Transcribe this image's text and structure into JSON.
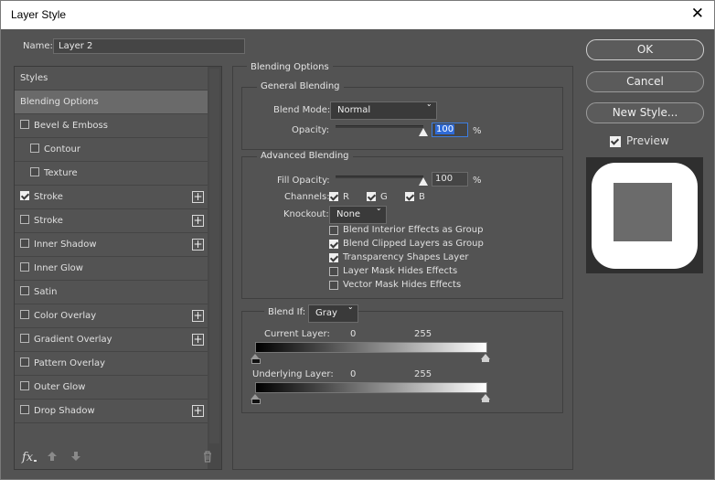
{
  "window": {
    "title": "Layer Style",
    "close_glyph": "✕"
  },
  "name_field": {
    "label": "Name:",
    "value": "Layer 2"
  },
  "styles_list": [
    {
      "label": "Styles",
      "checkbox": false,
      "checked": false,
      "plus": false,
      "indent": false,
      "selected": false
    },
    {
      "label": "Blending Options",
      "checkbox": false,
      "checked": false,
      "plus": false,
      "indent": false,
      "selected": true
    },
    {
      "label": "Bevel & Emboss",
      "checkbox": true,
      "checked": false,
      "plus": false,
      "indent": false,
      "selected": false
    },
    {
      "label": "Contour",
      "checkbox": true,
      "checked": false,
      "plus": false,
      "indent": true,
      "selected": false
    },
    {
      "label": "Texture",
      "checkbox": true,
      "checked": false,
      "plus": false,
      "indent": true,
      "selected": false
    },
    {
      "label": "Stroke",
      "checkbox": true,
      "checked": true,
      "plus": true,
      "indent": false,
      "selected": false
    },
    {
      "label": "Stroke",
      "checkbox": true,
      "checked": false,
      "plus": true,
      "indent": false,
      "selected": false
    },
    {
      "label": "Inner Shadow",
      "checkbox": true,
      "checked": false,
      "plus": true,
      "indent": false,
      "selected": false
    },
    {
      "label": "Inner Glow",
      "checkbox": true,
      "checked": false,
      "plus": false,
      "indent": false,
      "selected": false
    },
    {
      "label": "Satin",
      "checkbox": true,
      "checked": false,
      "plus": false,
      "indent": false,
      "selected": false
    },
    {
      "label": "Color Overlay",
      "checkbox": true,
      "checked": false,
      "plus": true,
      "indent": false,
      "selected": false
    },
    {
      "label": "Gradient Overlay",
      "checkbox": true,
      "checked": false,
      "plus": true,
      "indent": false,
      "selected": false
    },
    {
      "label": "Pattern Overlay",
      "checkbox": true,
      "checked": false,
      "plus": false,
      "indent": false,
      "selected": false
    },
    {
      "label": "Outer Glow",
      "checkbox": true,
      "checked": false,
      "plus": false,
      "indent": false,
      "selected": false
    },
    {
      "label": "Drop Shadow",
      "checkbox": true,
      "checked": false,
      "plus": true,
      "indent": false,
      "selected": false
    }
  ],
  "footer_icons": {
    "fx": "fx",
    "up": "up-arrow-icon",
    "down": "down-arrow-icon",
    "trash": "trash-icon"
  },
  "blending": {
    "section_title": "Blending Options",
    "general_title": "General Blending",
    "blend_mode_label": "Blend Mode:",
    "blend_mode_value": "Normal",
    "opacity_label": "Opacity:",
    "opacity_value": "100",
    "opacity_fraction": 1.0,
    "percent": "%",
    "advanced_title": "Advanced Blending",
    "fill_opacity_label": "Fill Opacity:",
    "fill_opacity_value": "100",
    "fill_opacity_fraction": 1.0,
    "channels_label": "Channels:",
    "channels": [
      {
        "label": "R",
        "checked": true
      },
      {
        "label": "G",
        "checked": true
      },
      {
        "label": "B",
        "checked": true
      }
    ],
    "knockout_label": "Knockout:",
    "knockout_value": "None",
    "options": [
      {
        "label": "Blend Interior Effects as Group",
        "checked": false
      },
      {
        "label": "Blend Clipped Layers as Group",
        "checked": true
      },
      {
        "label": "Transparency Shapes Layer",
        "checked": true
      },
      {
        "label": "Layer Mask Hides Effects",
        "checked": false
      },
      {
        "label": "Vector Mask Hides Effects",
        "checked": false
      }
    ],
    "blend_if_label": "Blend If:",
    "blend_if_value": "Gray",
    "current_layer_label": "Current Layer:",
    "underlying_layer_label": "Underlying Layer:",
    "range_low": "0",
    "range_high": "255"
  },
  "buttons": {
    "ok": "OK",
    "cancel": "Cancel",
    "new_style": "New Style..."
  },
  "preview": {
    "label": "Preview",
    "checked": true
  }
}
